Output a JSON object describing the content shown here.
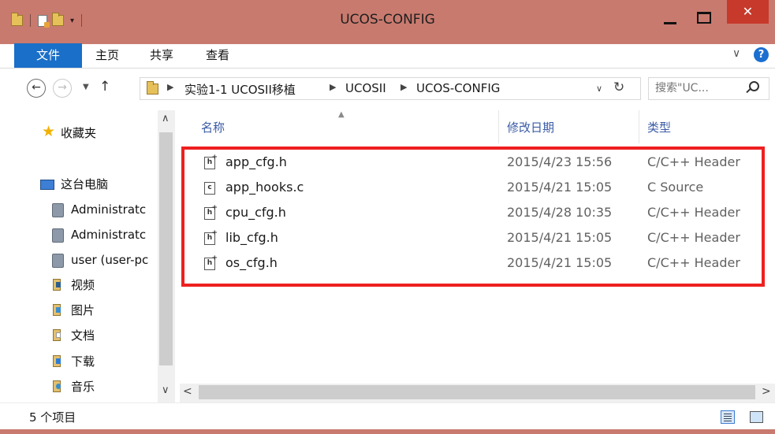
{
  "window": {
    "title": "UCOS-CONFIG",
    "close_glyph": "✕"
  },
  "quick_access": {
    "icons": [
      "folder-icon",
      "properties-icon",
      "new-folder-icon",
      "customize-qat-icon"
    ]
  },
  "ribbon": {
    "tabs": [
      {
        "label": "文件",
        "active": true
      },
      {
        "label": "主页"
      },
      {
        "label": "共享"
      },
      {
        "label": "查看"
      }
    ],
    "help_label": "?",
    "accent_color": "#1a6fc8"
  },
  "address_bar": {
    "breadcrumbs": [
      "实验1-1 UCOSII移植",
      "UCOSII",
      "UCOS-CONFIG"
    ],
    "search_placeholder": "搜索\"UC...",
    "refresh_glyph": "↻",
    "up_glyph": "↑",
    "back_glyph": "←",
    "forward_glyph": "→"
  },
  "navigation": {
    "favorites_label": "收藏夹",
    "this_pc_label": "这台电脑",
    "items": [
      {
        "label": "Administratc",
        "icon": "network-share-icon"
      },
      {
        "label": "Administratc",
        "icon": "network-share-icon"
      },
      {
        "label": "user (user-pc",
        "icon": "network-share-icon"
      },
      {
        "label": "视频",
        "icon": "video-library-icon"
      },
      {
        "label": "图片",
        "icon": "pictures-library-icon"
      },
      {
        "label": "文档",
        "icon": "documents-library-icon"
      },
      {
        "label": "下载",
        "icon": "downloads-icon"
      },
      {
        "label": "音乐",
        "icon": "music-library-icon"
      }
    ]
  },
  "file_list": {
    "columns": {
      "name": "名称",
      "date": "修改日期",
      "type": "类型"
    },
    "sort_column": "name",
    "rows": [
      {
        "name": "app_cfg.h",
        "date": "2015/4/23 15:56",
        "type": "C/C++ Header",
        "icon": "header-file-icon"
      },
      {
        "name": "app_hooks.c",
        "date": "2015/4/21 15:05",
        "type": "C Source",
        "icon": "c-source-file-icon"
      },
      {
        "name": "cpu_cfg.h",
        "date": "2015/4/28 10:35",
        "type": "C/C++ Header",
        "icon": "header-file-icon"
      },
      {
        "name": "lib_cfg.h",
        "date": "2015/4/21 15:05",
        "type": "C/C++ Header",
        "icon": "header-file-icon"
      },
      {
        "name": "os_cfg.h",
        "date": "2015/4/21 15:05",
        "type": "C/C++ Header",
        "icon": "header-file-icon"
      }
    ],
    "highlight_color": "#ee2020"
  },
  "status_bar": {
    "item_count": "5 个项目"
  }
}
